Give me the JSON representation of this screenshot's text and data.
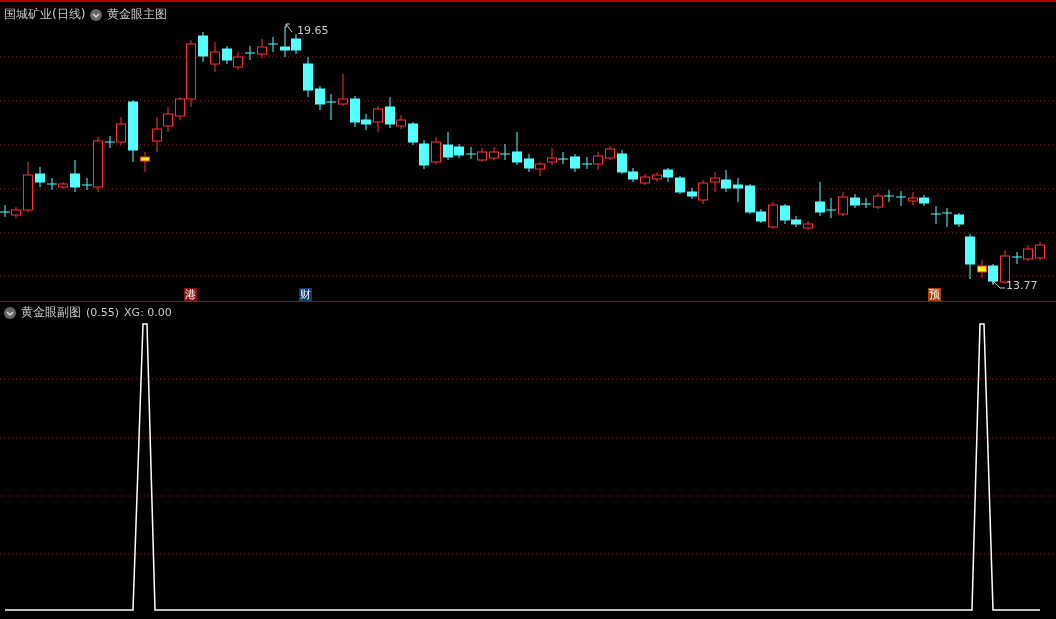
{
  "main_panel": {
    "stock_title": "国城矿业(日线)",
    "indicator": "黄金眼主图",
    "high_label": "19.65",
    "low_label": "13.77",
    "markers": [
      {
        "text": "港",
        "color": "#8b1010"
      },
      {
        "text": "财",
        "color": "#103a7a"
      },
      {
        "text": "预",
        "color": "#b0400f"
      }
    ]
  },
  "sub_panel": {
    "indicator": "黄金眼副图",
    "params": "(0.55)",
    "value": "XG: 0.00"
  }
}
